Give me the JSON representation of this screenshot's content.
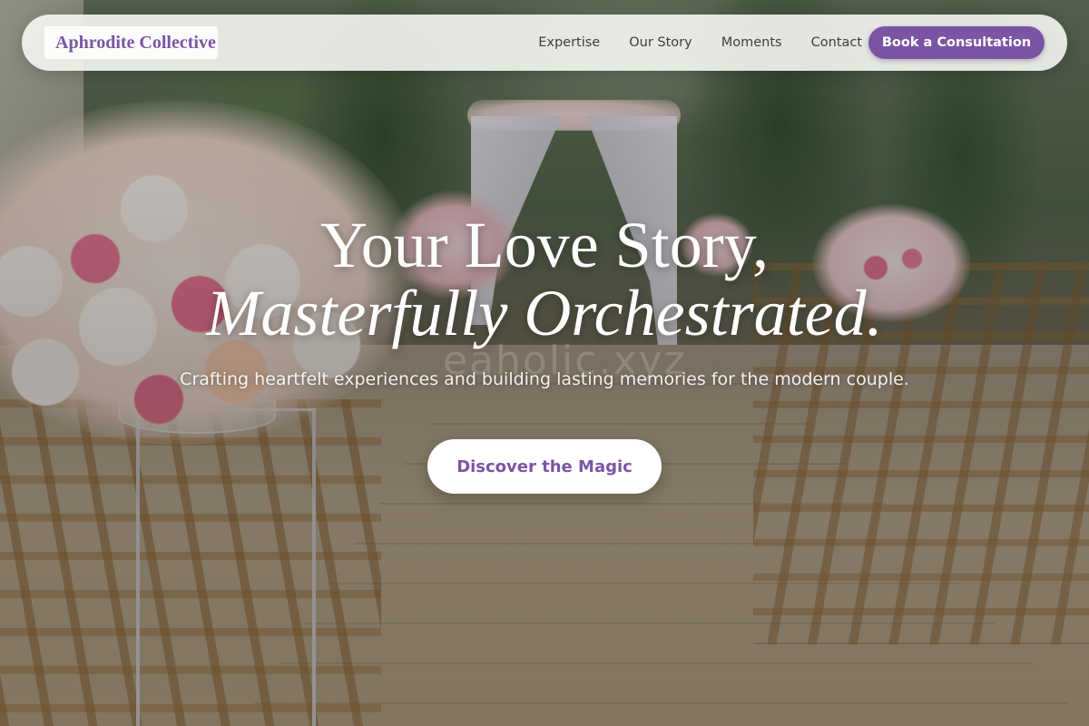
{
  "brand": {
    "name": "Aphrodite Collective"
  },
  "nav": {
    "links": [
      {
        "label": "Expertise"
      },
      {
        "label": "Our Story"
      },
      {
        "label": "Moments"
      },
      {
        "label": "Contact"
      }
    ],
    "cta_label": "Book a Consultation"
  },
  "hero": {
    "headline_line1": "Your Love Story,",
    "headline_line2": "Masterfully Orchestrated.",
    "subtitle": "Crafting heartfelt experiences and building lasting memories for the modern couple.",
    "button_label": "Discover the Magic",
    "background": "wedding-aisle-floral-photo",
    "watermark": "eaholic.xyz"
  },
  "colors": {
    "accent": "#7b55a3",
    "nav_background": "#f5f6f2",
    "hero_text": "#ffffff"
  }
}
